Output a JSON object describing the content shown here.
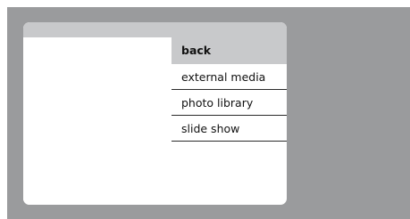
{
  "menu": {
    "items": [
      {
        "label": "back",
        "selected": true
      },
      {
        "label": "external media",
        "selected": false
      },
      {
        "label": "photo library",
        "selected": false
      },
      {
        "label": "slide show",
        "selected": false
      }
    ]
  }
}
